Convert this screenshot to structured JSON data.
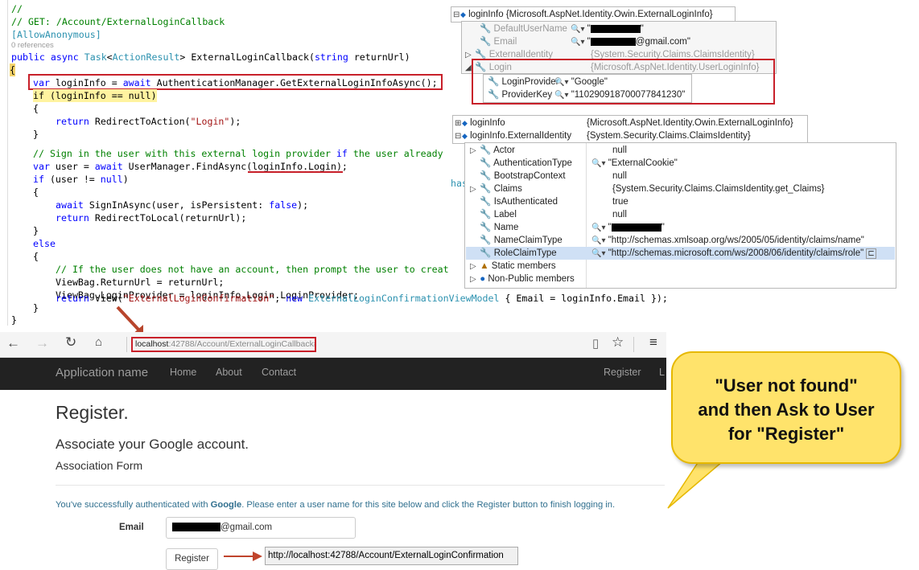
{
  "code": {
    "l1": "//",
    "l2": "// GET: /Account/ExternalLoginCallback",
    "l3": "[AllowAnonymous]",
    "l4": "0 references",
    "l5a": "public async ",
    "l5b": "Task",
    "l5c": "<",
    "l5d": "ActionResult",
    "l5e": "> ExternalLoginCallback(",
    "l5f": "string",
    "l5g": " returnUrl)",
    "l6": "{",
    "l7a": "var",
    "l7b": " loginInfo = ",
    "l7c": "await",
    "l7d": " AuthenticationManager.GetExternalLoginInfoAsync();",
    "l8": "if (loginInfo == null)",
    "l9": "{",
    "l10a": "return",
    "l10b": " RedirectToAction(",
    "l10c": "\"Login\"",
    "l10d": ");",
    "l11": "}",
    "l12a": "// Sign in the user with this external login provider ",
    "l12b": "if",
    "l12c": " the user already",
    "l13a": "var",
    "l13b": " user = ",
    "l13c": "await",
    "l13d": " UserManager.FindAsync(loginInfo.Login);",
    "l14a": "if",
    "l14b": " (user != ",
    "l14c": "null",
    "l14d": ")",
    "l15": "{",
    "l16a": "await",
    "l16b": " SignInAsync(user, isPersistent: ",
    "l16c": "false",
    "l16d": ");",
    "l17a": "return",
    "l17b": " RedirectToLocal(returnUrl);",
    "l18": "}",
    "l19": "else",
    "l20": "{",
    "l21": "// If the user does not have an account, then prompt the user to creat",
    "l22": "ViewBag.ReturnUrl = returnUrl;",
    "l23": "ViewBag.LoginProvider = loginInfo.Login.LoginProvider;",
    "l24a": "return",
    "l24b": " View(",
    "l24c": "\"ExternalLoginConfirmation\"",
    "l24d": ", ",
    "l24e": "new",
    "l24f": " ",
    "l24g": "ExternalLoginConfirmationViewModel",
    "l24h": " { Email = loginInfo.Email });",
    "l25": "}",
    "l26": "}",
    "has": "has"
  },
  "tip1": {
    "header_name": "loginInfo",
    "header_value": "{Microsoft.AspNet.Identity.Owin.ExternalLoginInfo}",
    "rows": [
      {
        "name": "DefaultUserName",
        "value": "\""
      },
      {
        "name": "Email",
        "value": "@gmail.com\""
      },
      {
        "name": "ExternalIdentity",
        "value": "{System.Security.Claims.ClaimsIdentity}"
      },
      {
        "name": "Login",
        "value": "{Microsoft.AspNet.Identity.UserLoginInfo}"
      }
    ],
    "sub": [
      {
        "name": "LoginProvider",
        "value": "\"Google\""
      },
      {
        "name": "ProviderKey",
        "value": "\"110290918700077841230\""
      }
    ]
  },
  "tip2": {
    "r1_name": "loginInfo",
    "r1_value": "{Microsoft.AspNet.Identity.Owin.ExternalLoginInfo}",
    "r2_name": "loginInfo.ExternalIdentity",
    "r2_value": "{System.Security.Claims.ClaimsIdentity}",
    "rows": [
      {
        "name": "Actor",
        "value": "null"
      },
      {
        "name": "AuthenticationType",
        "value": "\"ExternalCookie\""
      },
      {
        "name": "BootstrapContext",
        "value": "null"
      },
      {
        "name": "Claims",
        "value": "{System.Security.Claims.ClaimsIdentity.get_Claims}"
      },
      {
        "name": "IsAuthenticated",
        "value": "true"
      },
      {
        "name": "Label",
        "value": "null"
      },
      {
        "name": "Name",
        "value": "\""
      },
      {
        "name": "NameClaimType",
        "value": "\"http://schemas.xmlsoap.org/ws/2005/05/identity/claims/name\""
      },
      {
        "name": "RoleClaimType",
        "value": "\"http://schemas.microsoft.com/ws/2008/06/identity/claims/role\""
      },
      {
        "name": "Static members",
        "value": ""
      },
      {
        "name": "Non-Public members",
        "value": ""
      }
    ]
  },
  "browser": {
    "url_host": "localhost",
    "url_path": ":42788/Account/ExternalLoginCallback#"
  },
  "nav": {
    "brand": "Application name",
    "home": "Home",
    "about": "About",
    "contact": "Contact",
    "register": "Register",
    "login_partial": "L"
  },
  "page": {
    "title": "Register.",
    "subtitle": "Associate your Google account.",
    "form_title": "Association Form",
    "info_pre": "You've successfully authenticated with ",
    "info_bold": "Google",
    "info_post": ". Please enter a user name for this site below and click the Register button to finish logging in.",
    "email_label": "Email",
    "email_value": "@gmail.com",
    "register_button": "Register",
    "confirmation_url": "http://localhost:42788/Account/ExternalLoginConfirmation"
  },
  "callout": {
    "line1": "\"User not found\"",
    "line2": "and then Ask to User",
    "line3": "for \"Register\""
  },
  "colors": {
    "highlight_box": "#c8202a",
    "callout": "#ffe36b",
    "navbar": "#222222"
  }
}
